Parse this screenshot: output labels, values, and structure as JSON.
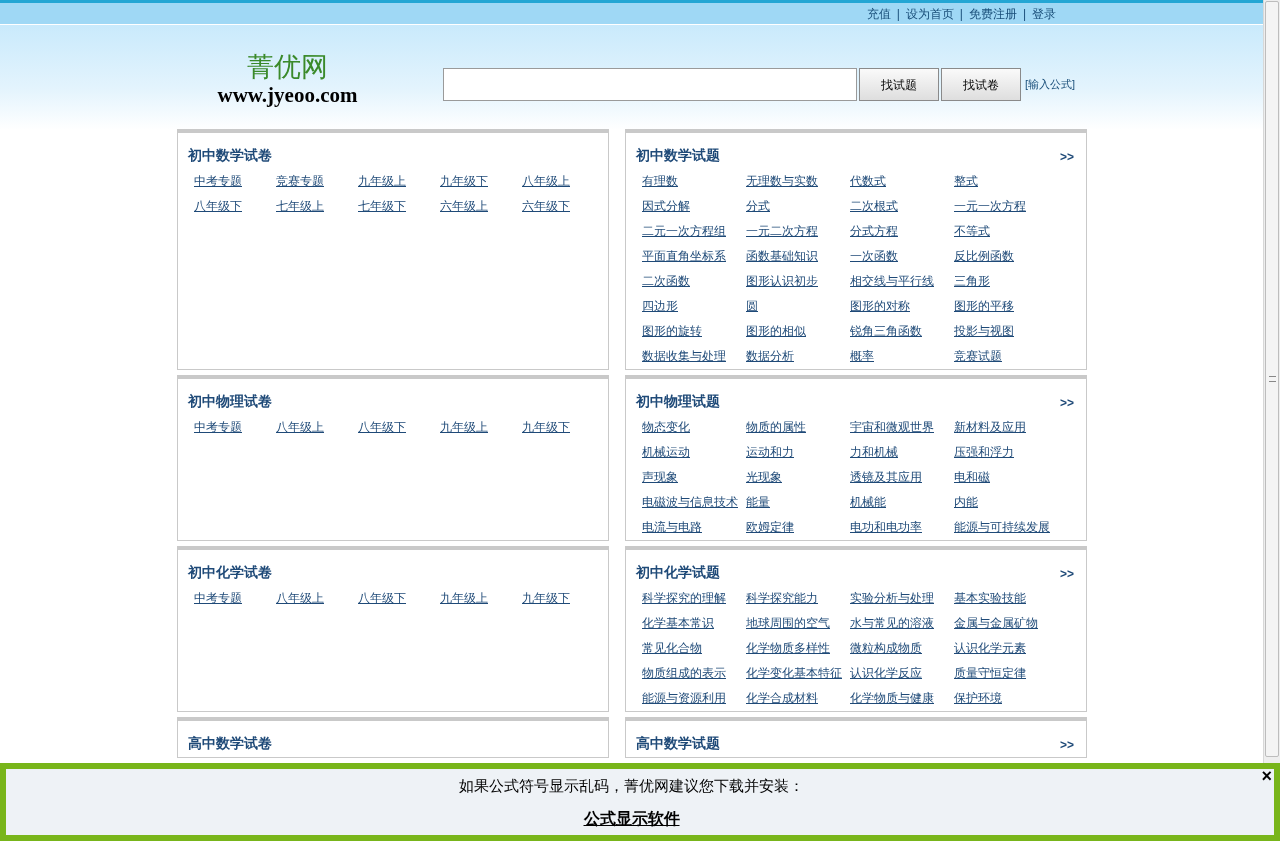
{
  "top_bar": {
    "links": [
      "充值",
      "设为首页",
      "免费注册",
      "登录"
    ],
    "separator": "|"
  },
  "logo": {
    "name": "菁优网",
    "url": "www.jyeoo.com"
  },
  "search": {
    "buttons": [
      "找试题",
      "找试卷"
    ],
    "formula_link": "[输入公式]"
  },
  "sections": [
    {
      "papers": {
        "title": "初中数学试卷",
        "links": [
          "中考专题",
          "竞赛专题",
          "九年级上",
          "九年级下",
          "八年级上",
          "八年级下",
          "七年级上",
          "七年级下",
          "六年级上",
          "六年级下"
        ]
      },
      "questions": {
        "title": "初中数学试题",
        "more": ">>",
        "links": [
          "有理数",
          "无理数与实数",
          "代数式",
          "整式",
          "因式分解",
          "分式",
          "二次根式",
          "一元一次方程",
          "二元一次方程组",
          "一元二次方程",
          "分式方程",
          "不等式",
          "平面直角坐标系",
          "函数基础知识",
          "一次函数",
          "反比例函数",
          "二次函数",
          "图形认识初步",
          "相交线与平行线",
          "三角形",
          "四边形",
          "圆",
          "图形的对称",
          "图形的平移",
          "图形的旋转",
          "图形的相似",
          "锐角三角函数",
          "投影与视图",
          "数据收集与处理",
          "数据分析",
          "概率",
          "竞赛试题"
        ]
      }
    },
    {
      "papers": {
        "title": "初中物理试卷",
        "links": [
          "中考专题",
          "八年级上",
          "八年级下",
          "九年级上",
          "九年级下"
        ]
      },
      "questions": {
        "title": "初中物理试题",
        "more": ">>",
        "links": [
          "物态变化",
          "物质的属性",
          "宇宙和微观世界",
          "新材料及应用",
          "机械运动",
          "运动和力",
          "力和机械",
          "压强和浮力",
          "声现象",
          "光现象",
          "透镜及其应用",
          "电和磁",
          "电磁波与信息技术",
          "能量",
          "机械能",
          "内能",
          "电流与电路",
          "欧姆定律",
          "电功和电功率",
          "能源与可持续发展"
        ]
      }
    },
    {
      "papers": {
        "title": "初中化学试卷",
        "links": [
          "中考专题",
          "八年级上",
          "八年级下",
          "九年级上",
          "九年级下"
        ]
      },
      "questions": {
        "title": "初中化学试题",
        "more": ">>",
        "links": [
          "科学探究的理解",
          "科学探究能力",
          "实验分析与处理",
          "基本实验技能",
          "化学基本常识",
          "地球周围的空气",
          "水与常见的溶液",
          "金属与金属矿物",
          "常见化合物",
          "化学物质多样性",
          "微粒构成物质",
          "认识化学元素",
          "物质组成的表示",
          "化学变化基本特征",
          "认识化学反应",
          "质量守恒定律",
          "能源与资源利用",
          "化学合成材料",
          "化学物质与健康",
          "保护环境"
        ]
      }
    },
    {
      "papers": {
        "title": "高中数学试卷"
      },
      "questions": {
        "title": "高中数学试题",
        "more": ">>"
      }
    }
  ],
  "notice": {
    "message": "如果公式符号显示乱码，菁优网建议您下载并安装：",
    "link": "公式显示软件",
    "close": "×"
  }
}
